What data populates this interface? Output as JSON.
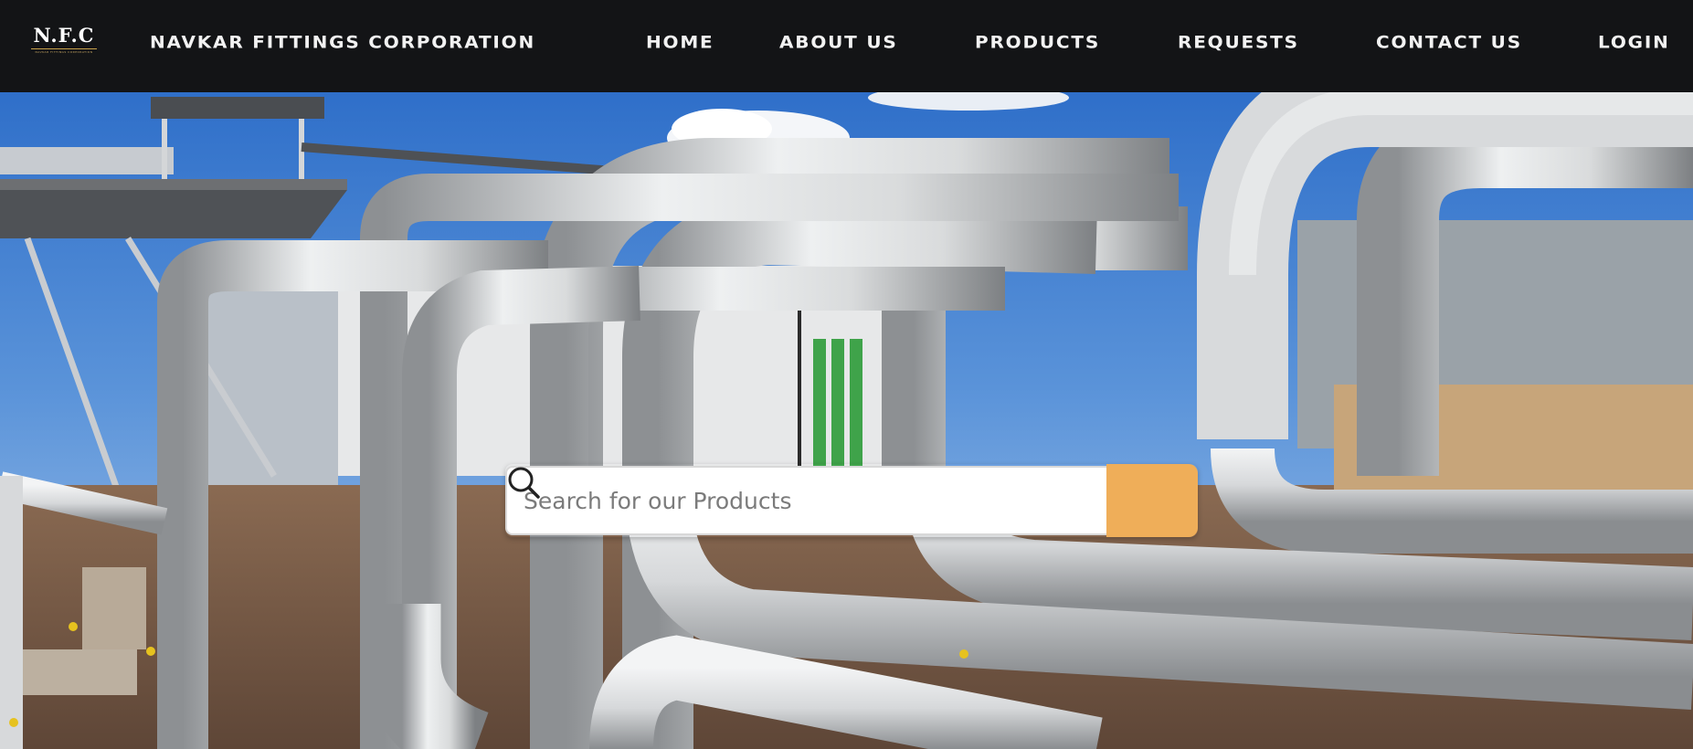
{
  "brand": {
    "logo_text": "N.F.C",
    "logo_subtext": "NAVKAR FITTINGS CORPORATION",
    "name": "Navkar Fittings Corporation"
  },
  "nav": {
    "items": [
      {
        "label": "Home"
      },
      {
        "label": "About Us"
      },
      {
        "label": "Products"
      },
      {
        "label": "Requests"
      },
      {
        "label": "Contact Us"
      },
      {
        "label": "Login"
      }
    ]
  },
  "search": {
    "placeholder": "Search for our Products",
    "value": "",
    "button_icon": "search-icon"
  },
  "hero": {
    "image": "industrial-pipelines-photo"
  },
  "colors": {
    "navbar_bg": "#131416",
    "nav_text": "#f2f2f2",
    "search_button": "#efae59",
    "logo_accent": "#c9a24a"
  }
}
